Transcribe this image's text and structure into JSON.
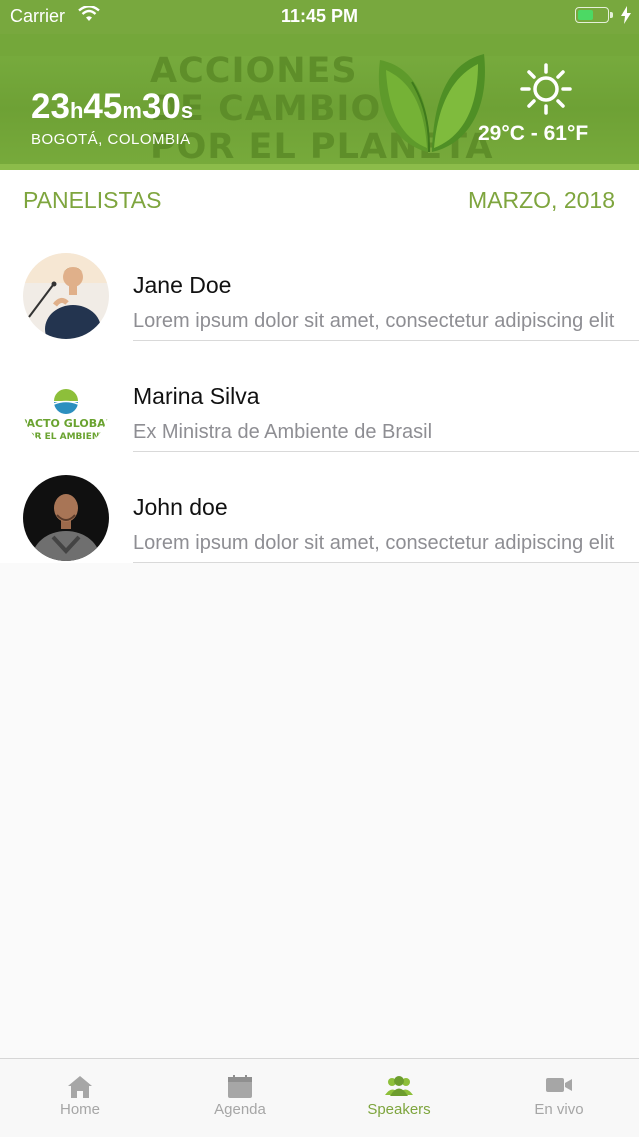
{
  "status_bar": {
    "carrier": "Carrier",
    "time": "11:45 PM",
    "battery_level": 0.55
  },
  "header": {
    "title_lines": [
      "ACCIONES",
      "DE CAMBIO",
      "POR EL PLANETA"
    ],
    "countdown": {
      "hours": "23",
      "h": "h",
      "minutes": "45",
      "m": "m",
      "seconds": "30",
      "s": "s"
    },
    "location": "BOGOTÁ, COLOMBIA",
    "weather_icon": "sun-icon",
    "temperature": "29°C - 61°F"
  },
  "section": {
    "title": "PANELISTAS",
    "date": "MARZO, 2018"
  },
  "speakers": [
    {
      "name": "Jane Doe",
      "subtitle": "Lorem ipsum dolor sit amet, consectetur adipiscing elit"
    },
    {
      "name": "Marina Silva",
      "subtitle": "Ex Ministra de Ambiente de Brasil",
      "logo_lines": [
        "PACTO GLOBAL",
        "POR EL AMBIENTE"
      ]
    },
    {
      "name": "John doe",
      "subtitle": "Lorem ipsum dolor sit amet, consectetur adipiscing elit"
    }
  ],
  "tabs": [
    {
      "label": "Home",
      "icon": "home-icon"
    },
    {
      "label": "Agenda",
      "icon": "calendar-icon"
    },
    {
      "label": "Speakers",
      "icon": "people-icon"
    },
    {
      "label": "En vivo",
      "icon": "video-camera-icon"
    }
  ],
  "colors": {
    "brand_green": "#78a83e",
    "accent_text": "#7ea53e",
    "inactive_tab": "#a6a6a6"
  }
}
